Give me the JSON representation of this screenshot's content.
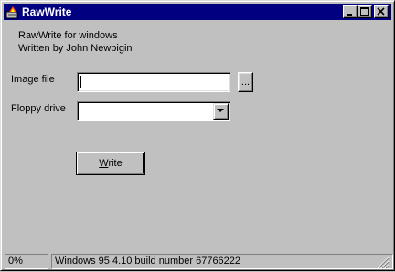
{
  "window": {
    "title": "RawWrite",
    "icons": {
      "app": "floppy-writer-icon",
      "minimize": "minimize-icon",
      "maximize": "maximize-icon",
      "close": "close-icon"
    }
  },
  "about": {
    "line1": "RawWrite for windows",
    "line2": "Written by John Newbigin"
  },
  "image_file": {
    "label": "Image file",
    "value": "",
    "placeholder": "",
    "browse_label": "..."
  },
  "floppy_drive": {
    "label": "Floppy drive",
    "selected": "",
    "dropdown_icon": "chevron-down-icon"
  },
  "write_button": {
    "label_mnemonic": "W",
    "label_rest": "rite"
  },
  "status": {
    "progress": "0%",
    "message": "Windows 95 4.10 build number 67766222"
  },
  "colors": {
    "titlebar": "#000080",
    "face": "#c0c0c0"
  }
}
